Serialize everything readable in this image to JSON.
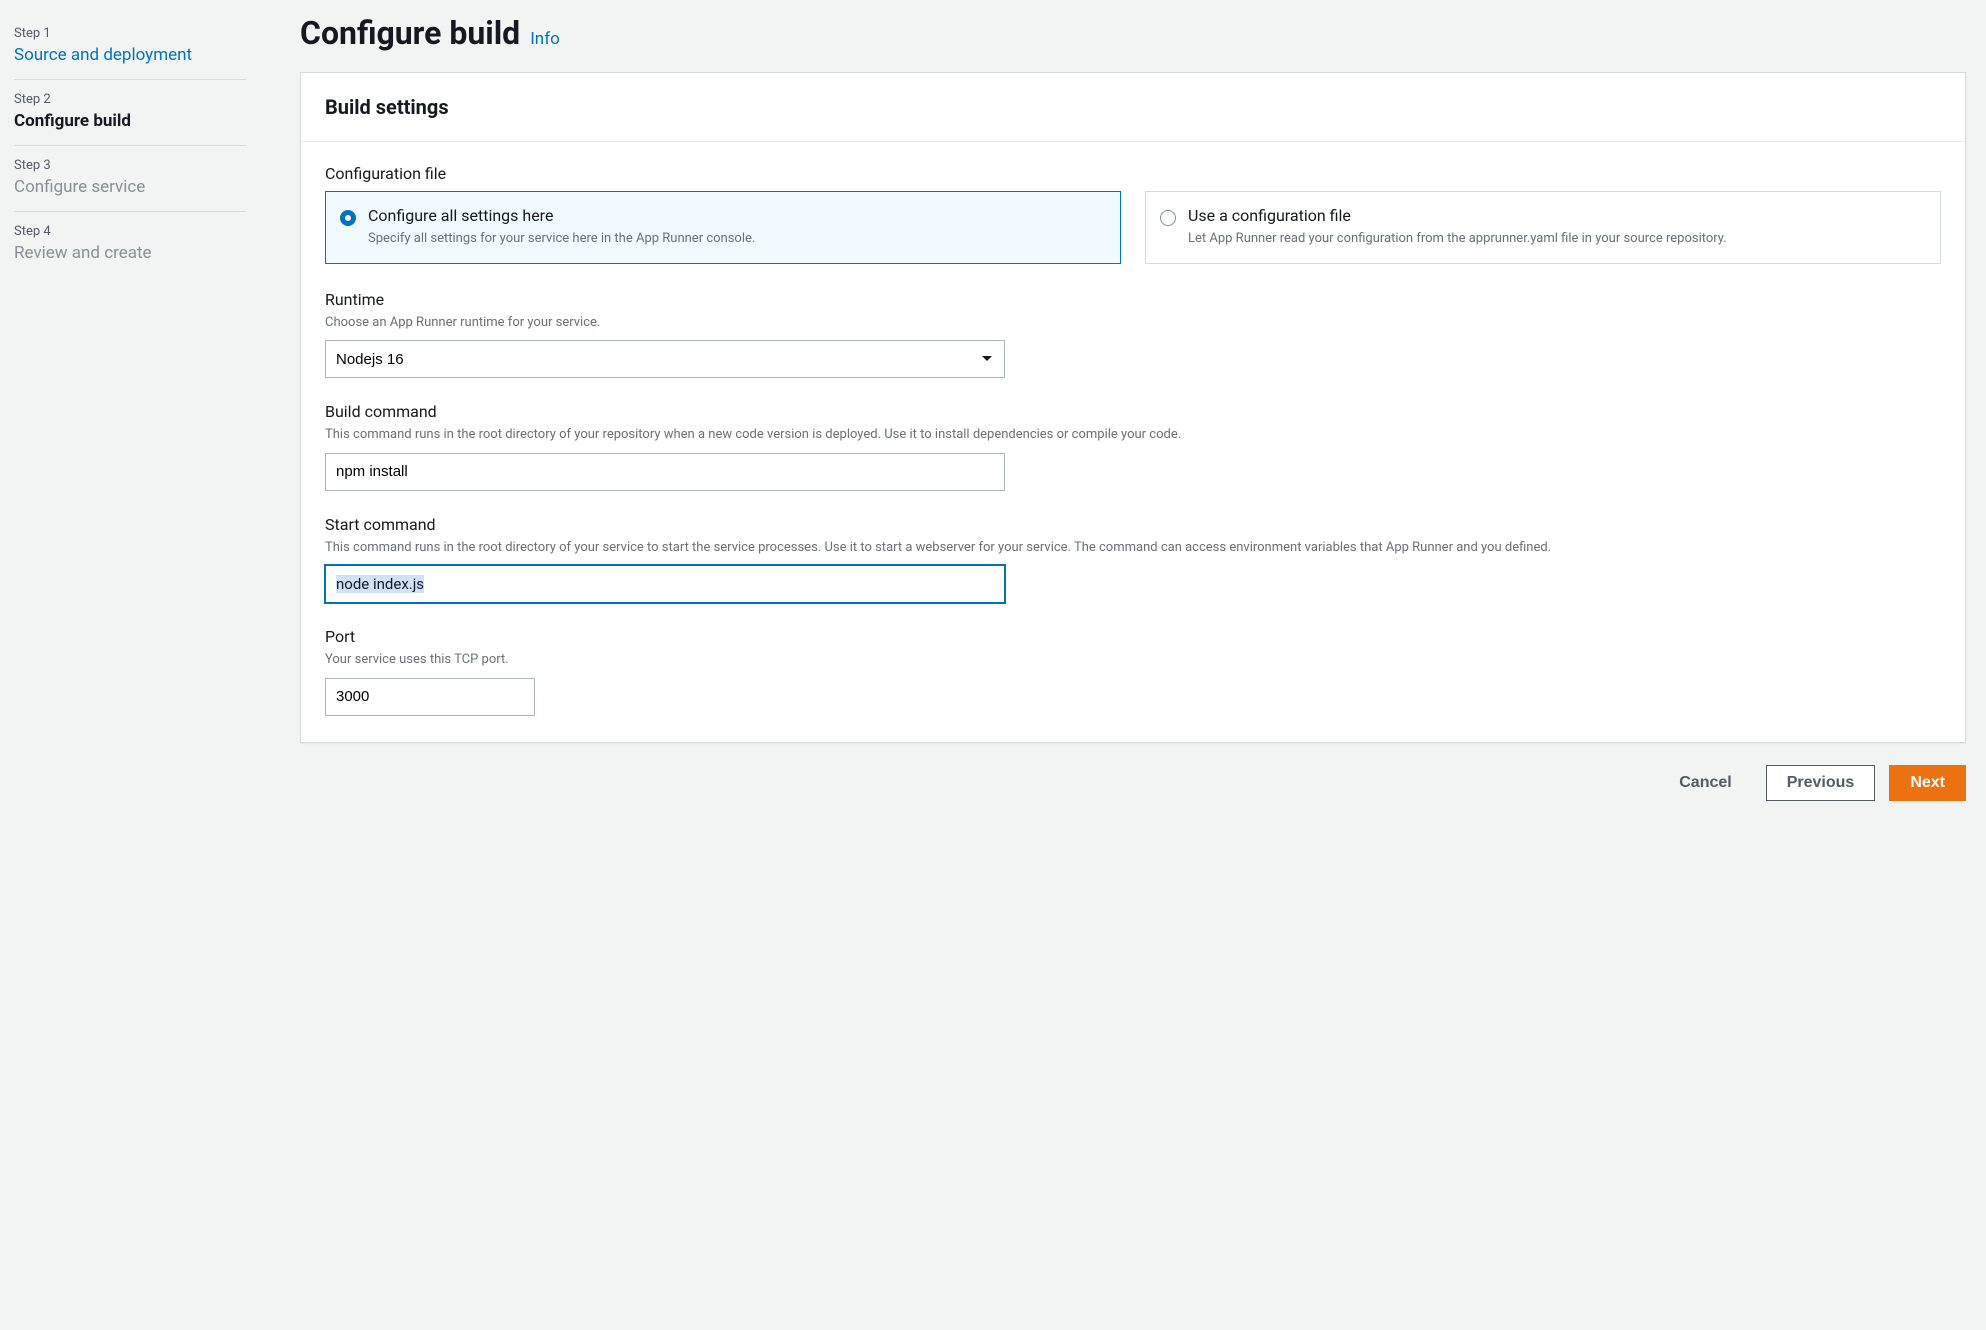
{
  "sidebar": {
    "steps": [
      {
        "number": "Step 1",
        "title": "Source and deployment"
      },
      {
        "number": "Step 2",
        "title": "Configure build"
      },
      {
        "number": "Step 3",
        "title": "Configure service"
      },
      {
        "number": "Step 4",
        "title": "Review and create"
      }
    ]
  },
  "header": {
    "title": "Configure build",
    "info": "Info"
  },
  "panel": {
    "title": "Build settings"
  },
  "config_file": {
    "label": "Configuration file",
    "option_a": {
      "title": "Configure all settings here",
      "desc": "Specify all settings for your service here in the App Runner console."
    },
    "option_b": {
      "title": "Use a configuration file",
      "desc": "Let App Runner read your configuration from the apprunner.yaml file in your source repository."
    }
  },
  "runtime": {
    "label": "Runtime",
    "desc": "Choose an App Runner runtime for your service.",
    "value": "Nodejs 16"
  },
  "build_command": {
    "label": "Build command",
    "desc": "This command runs in the root directory of your repository when a new code version is deployed. Use it to install dependencies or compile your code.",
    "value": "npm install"
  },
  "start_command": {
    "label": "Start command",
    "desc": "This command runs in the root directory of your service to start the service processes. Use it to start a webserver for your service. The command can access environment variables that App Runner and you defined.",
    "value": "node index.js"
  },
  "port": {
    "label": "Port",
    "desc": "Your service uses this TCP port.",
    "value": "3000"
  },
  "footer": {
    "cancel": "Cancel",
    "previous": "Previous",
    "next": "Next"
  }
}
